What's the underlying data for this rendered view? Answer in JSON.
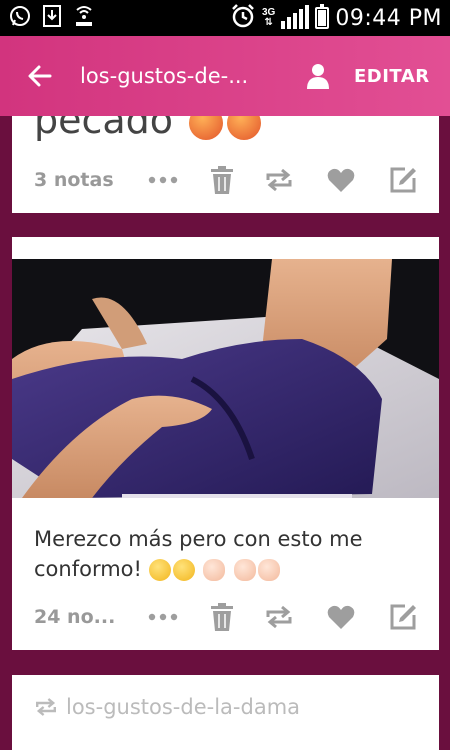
{
  "status_bar": {
    "network": "3G",
    "time": "09:44 PM"
  },
  "header": {
    "title": "los-gustos-de-...",
    "edit_label": "EDITAR"
  },
  "post1": {
    "partial_text": "pecado",
    "notes": "3 notas"
  },
  "post2": {
    "caption": "Merezco más pero con esto me conformo!",
    "notes": "24 no..."
  },
  "post3": {
    "reblog_source": "los-gustos-de-la-dama"
  },
  "colors": {
    "header": "#d93f86",
    "background": "#6a0f3e",
    "icon": "#9e9e9e"
  }
}
